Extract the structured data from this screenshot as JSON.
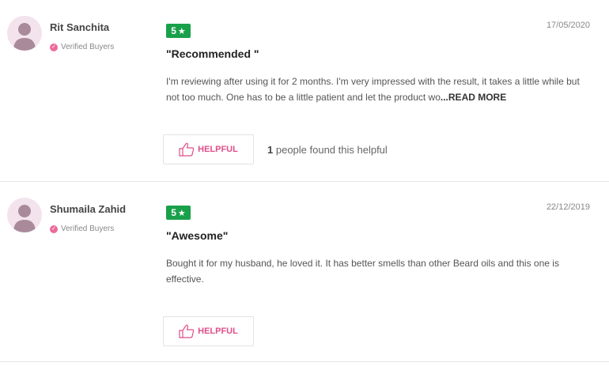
{
  "reviews": [
    {
      "reviewer": "Rit Sanchita",
      "verified_label": "Verified Buyers",
      "rating": "5",
      "date": "17/05/2020",
      "title": "\"Recommended \"",
      "body": "I'm reviewing after using it for 2 months. I'm very impressed with the result, it takes a little while but not too much. One has to be a little patient and let the product wo",
      "read_more": "...READ MORE",
      "helpful_label": "HELPFUL",
      "helpful_count": "1",
      "helpful_text": "people found this helpful"
    },
    {
      "reviewer": "Shumaila Zahid",
      "verified_label": "Verified Buyers",
      "rating": "5",
      "date": "22/12/2019",
      "title": "\"Awesome\"",
      "body": "Bought it for my husband, he loved it. It has better smells than other Beard oils and this one is effective.",
      "helpful_label": "HELPFUL"
    }
  ],
  "icons": {
    "star": "star-icon",
    "thumb": "thumbs-up-icon",
    "verified": "check-circle-icon",
    "avatar": "user-avatar-icon"
  },
  "colors": {
    "rating_green": "#19a04a",
    "accent_pink": "#e04e8a",
    "avatar_bg": "#f3e3ec"
  }
}
